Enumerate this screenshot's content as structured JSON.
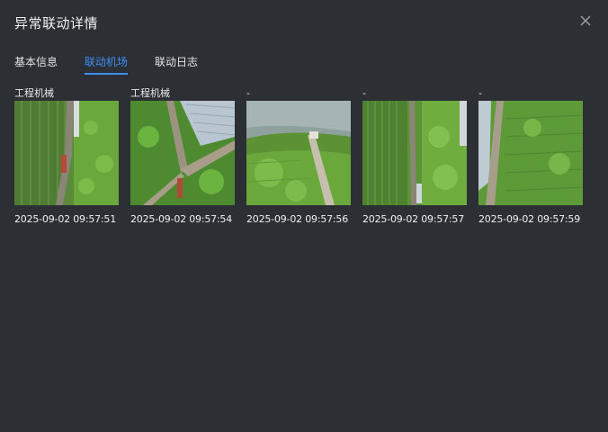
{
  "dialog": {
    "title": "异常联动详情"
  },
  "tabs": [
    {
      "label": "基本信息"
    },
    {
      "label": "联动机场"
    },
    {
      "label": "联动日志"
    }
  ],
  "captures": [
    {
      "label": "工程机械",
      "time": "2025-09-02 09:57:51"
    },
    {
      "label": "工程机械",
      "time": "2025-09-02 09:57:54"
    },
    {
      "label": "-",
      "time": "2025-09-02 09:57:56"
    },
    {
      "label": "-",
      "time": "2025-09-02 09:57:57"
    },
    {
      "label": "-",
      "time": "2025-09-02 09:57:59"
    }
  ],
  "colors": {
    "accent": "#3d8ff5",
    "background": "#2c2f33"
  }
}
